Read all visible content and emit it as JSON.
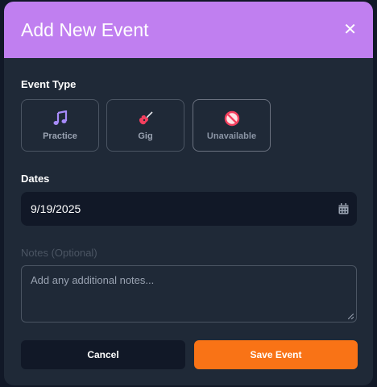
{
  "modal": {
    "title": "Add New Event",
    "close_glyph": "✕"
  },
  "event_type": {
    "label": "Event Type",
    "options": [
      {
        "label": "Practice",
        "icon": "music-note-icon",
        "color": "#a78bfa"
      },
      {
        "label": "Gig",
        "icon": "guitar-icon",
        "color": "#f43f5e"
      },
      {
        "label": "Unavailable",
        "icon": "prohibited-icon",
        "color": "#f43f5e",
        "selected": true
      }
    ]
  },
  "dates": {
    "label": "Dates",
    "value": "9/19/2025",
    "icon": "calendar-icon"
  },
  "notes": {
    "label": "Notes (Optional)",
    "placeholder": "Add any additional notes..."
  },
  "actions": {
    "cancel_label": "Cancel",
    "save_label": "Save Event"
  },
  "colors": {
    "header": "#c07ff0",
    "primary": "#f97316",
    "panel": "#1f2937",
    "background": "#111827"
  }
}
